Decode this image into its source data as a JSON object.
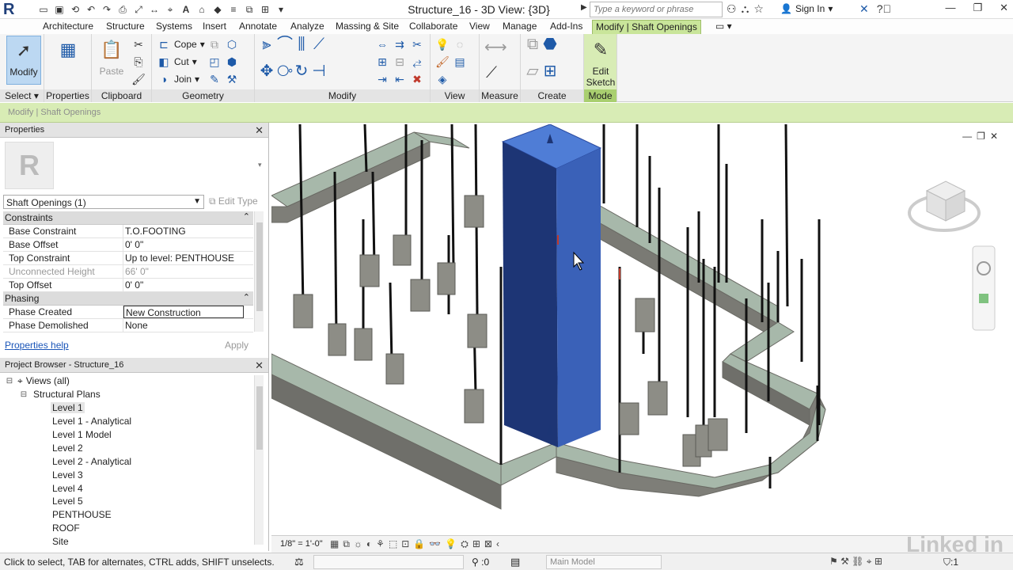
{
  "title_bar": {
    "logo": "R",
    "window_title": "Structure_16 - 3D View: {3D}",
    "search_placeholder": "Type a keyword or phrase",
    "sign_in": "Sign In"
  },
  "tabs": [
    "Architecture",
    "Structure",
    "Systems",
    "Insert",
    "Annotate",
    "Analyze",
    "Massing & Site",
    "Collaborate",
    "View",
    "Manage",
    "Add-Ins",
    "Modify | Shaft Openings"
  ],
  "ribbon": {
    "select": {
      "button": "Modify",
      "label": "Select"
    },
    "properties": {
      "label": "Properties"
    },
    "clipboard": {
      "paste": "Paste",
      "label": "Clipboard"
    },
    "geometry": {
      "cope": "Cope",
      "cut": "Cut",
      "join": "Join",
      "label": "Geometry"
    },
    "modify": {
      "label": "Modify"
    },
    "view": {
      "label": "View"
    },
    "measure": {
      "label": "Measure"
    },
    "create": {
      "label": "Create"
    },
    "mode": {
      "button_line1": "Edit",
      "button_line2": "Sketch",
      "label": "Mode"
    }
  },
  "options_bar": {
    "text": "Modify | Shaft Openings"
  },
  "properties": {
    "header": "Properties",
    "instance": "Shaft Openings (1)",
    "edit_type": "Edit Type",
    "sections": [
      {
        "name": "Constraints",
        "rows": [
          {
            "key": "Base Constraint",
            "value": "T.O.FOOTING"
          },
          {
            "key": "Base Offset",
            "value": "0'  0\""
          },
          {
            "key": "Top Constraint",
            "value": "Up to level: PENTHOUSE"
          },
          {
            "key": "Unconnected Height",
            "value": "66'  0\""
          },
          {
            "key": "Top Offset",
            "value": "0'  0\""
          }
        ]
      },
      {
        "name": "Phasing",
        "rows": [
          {
            "key": "Phase Created",
            "value": "New Construction"
          },
          {
            "key": "Phase Demolished",
            "value": "None"
          }
        ]
      }
    ],
    "help_link": "Properties help",
    "apply": "Apply"
  },
  "browser": {
    "header": "Project Browser - Structure_16",
    "root": "Views (all)",
    "group": "Structural Plans",
    "items": [
      "Level 1",
      "Level 1 - Analytical",
      "Level 1 Model",
      "Level 2",
      "Level 2 - Analytical",
      "Level 3",
      "Level 4",
      "Level 5",
      "PENTHOUSE",
      "ROOF",
      "Site"
    ]
  },
  "view_bar": {
    "scale": "1/8\" = 1'-0\""
  },
  "status_bar": {
    "message": "Click to select, TAB for alternates, CTRL adds, SHIFT unselects.",
    "count": ":0",
    "model": "Main Model",
    "filter": ":1"
  },
  "watermark": "Linked in",
  "colors": {
    "context_tab": "#c9e59a",
    "shaft_blue": "#2f4f9e",
    "foundation_green": "#9fb8a8"
  }
}
